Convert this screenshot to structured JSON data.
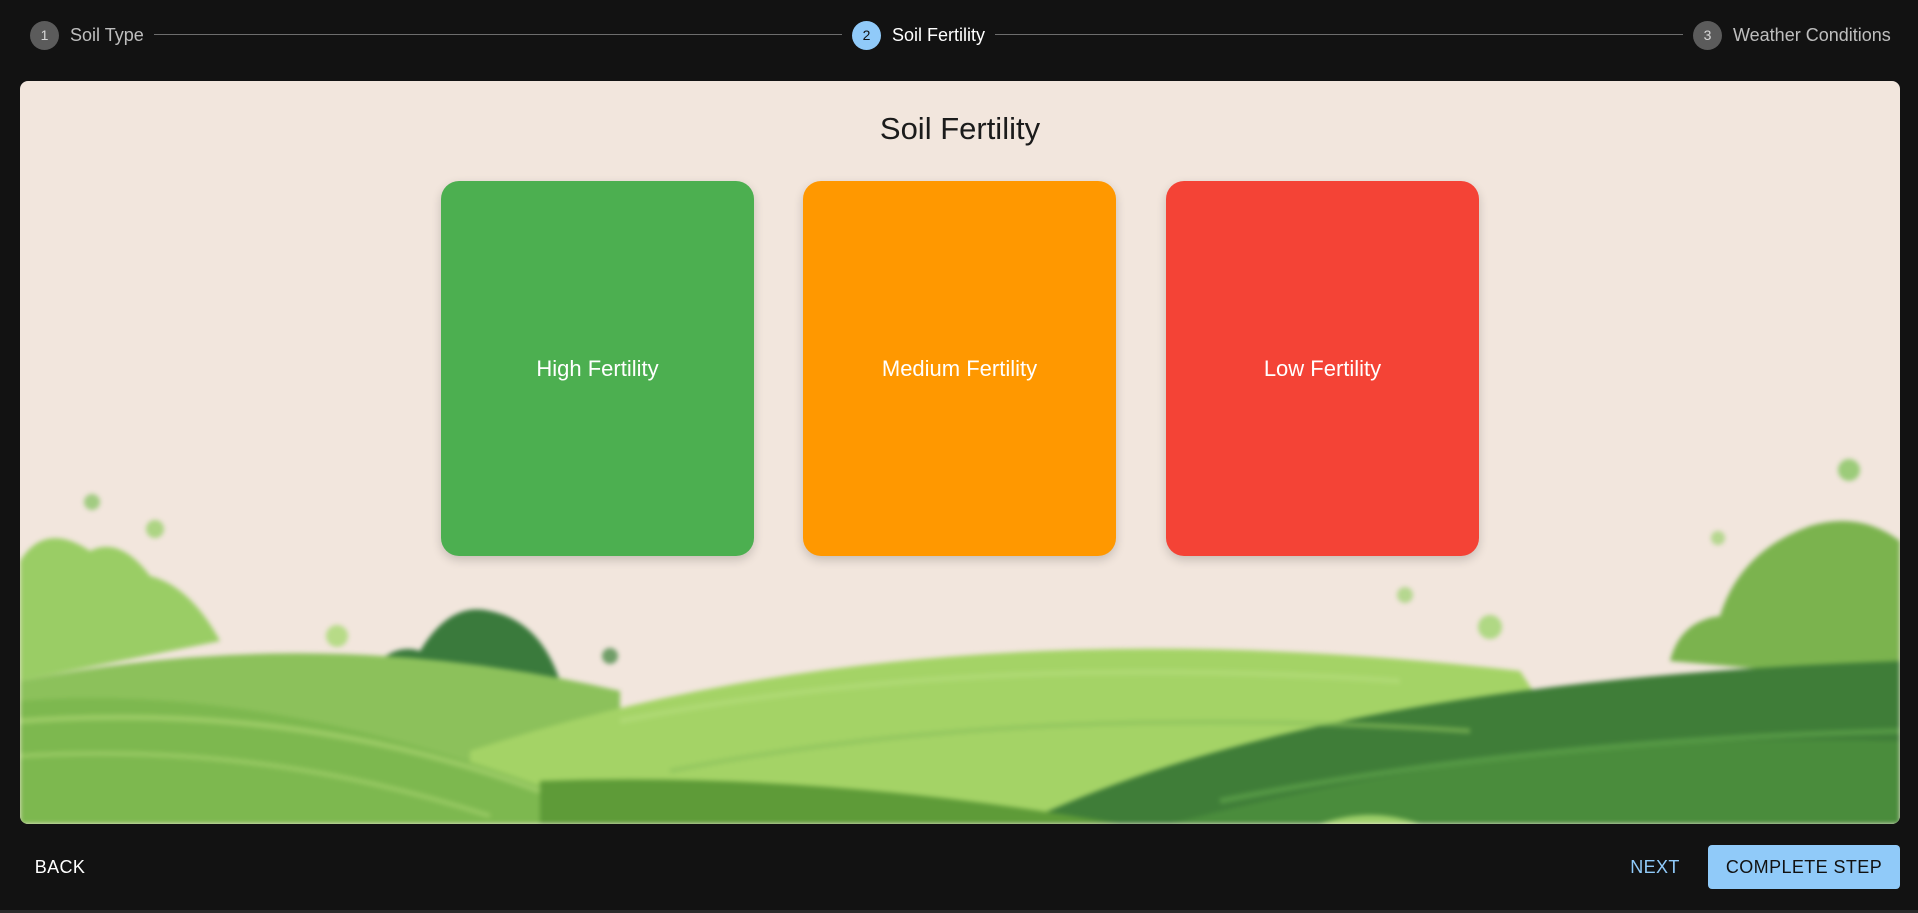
{
  "stepper": {
    "steps": [
      {
        "number": "1",
        "label": "Soil Type"
      },
      {
        "number": "2",
        "label": "Soil Fertility"
      },
      {
        "number": "3",
        "label": "Weather Conditions"
      }
    ],
    "active_step": 2
  },
  "panel": {
    "title": "Soil Fertility",
    "options": [
      {
        "label": "High Fertility",
        "color": "#4caf50"
      },
      {
        "label": "Medium Fertility",
        "color": "#ff9800"
      },
      {
        "label": "Low Fertility",
        "color": "#f44336"
      }
    ],
    "background": "green-hills-landscape"
  },
  "footer": {
    "back_label": "BACK",
    "next_label": "NEXT",
    "complete_label": "COMPLETE STEP"
  },
  "colors": {
    "accent": "#90caf9",
    "page_bg": "#121212",
    "panel_bg": "#f2e6dd"
  }
}
